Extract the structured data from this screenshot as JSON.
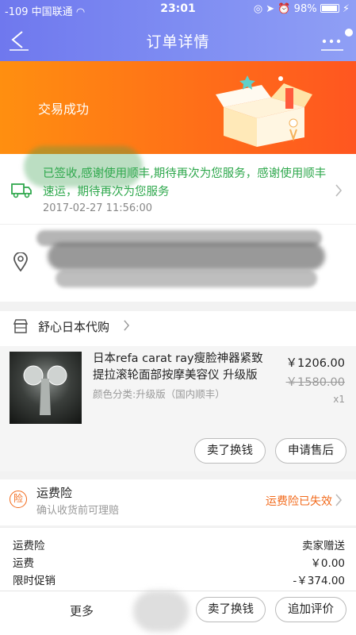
{
  "status_bar": {
    "signal": "-109",
    "carrier": "中国联通",
    "time": "23:01",
    "battery": "98%"
  },
  "nav": {
    "title": "订单详情",
    "back_icon": "back-arrow-icon",
    "more_icon": "more-dots-icon"
  },
  "banner": {
    "status_text": "交易成功"
  },
  "logistics": {
    "message": "已签收,感谢使用顺丰,期待再次为您服务，感谢使用顺丰速运，期待再次为您服务",
    "time": "2017-02-27 11:56:00"
  },
  "shop": {
    "name": "舒心日本代购"
  },
  "product": {
    "title": "日本refa carat ray瘦脸神器紧致提拉滚轮面部按摩美容仪 升级版",
    "sku": "颜色分类:升级版（国内顺丰）",
    "price": "￥1206.00",
    "original_price": "￥1580.00",
    "quantity": "x1"
  },
  "actions": {
    "sell_button": "卖了换钱",
    "after_sale_button": "申请售后",
    "review_button": "追加评价",
    "more": "更多"
  },
  "insurance": {
    "title": "运费险",
    "subtitle": "确认收货前可理赔",
    "status": "运费险已失效"
  },
  "fees": [
    {
      "label": "运费险",
      "value": "卖家赠送"
    },
    {
      "label": "运费",
      "value": "￥0.00"
    },
    {
      "label": "限时促销",
      "value": "-￥374.00"
    }
  ],
  "colors": {
    "header": "#7e8cf2",
    "banner": "#ff6f18",
    "accent_orange": "#f26a1b",
    "logistics_green": "#2fa84d"
  }
}
